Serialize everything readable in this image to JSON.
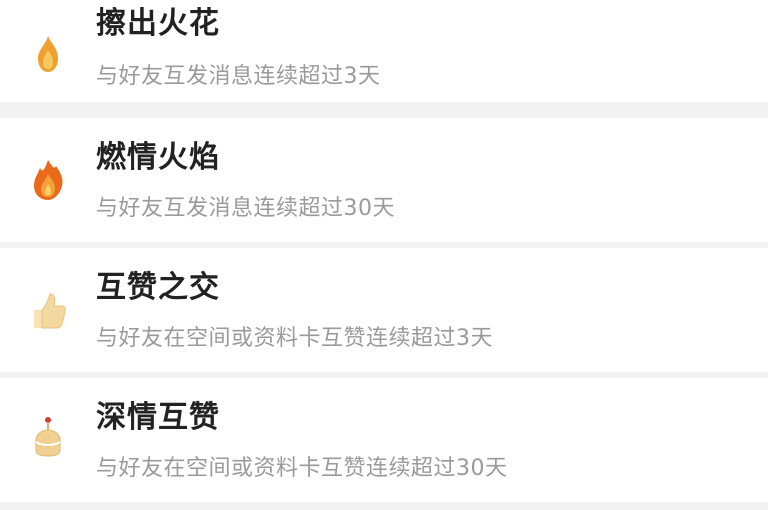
{
  "achievements": [
    {
      "icon": "small-flame-icon",
      "title": "擦出火花",
      "desc": "与好友互发消息连续超过3天",
      "color": "#f0a030"
    },
    {
      "icon": "big-flame-icon",
      "title": "燃情火焰",
      "desc": "与好友互发消息连续超过30天",
      "color": "#e86a1a"
    },
    {
      "icon": "small-like-icon",
      "title": "互赞之交",
      "desc": "与好友在空间或资料卡互赞连续超过3天",
      "color": "#f3d9a0"
    },
    {
      "icon": "cake-like-icon",
      "title": "深情互赞",
      "desc": "与好友在空间或资料卡互赞连续超过30天",
      "color": "#f0d090"
    }
  ],
  "colors": {
    "background": "#f2f2f2",
    "row": "#ffffff",
    "title": "#222222",
    "desc": "#9a9a9a"
  }
}
